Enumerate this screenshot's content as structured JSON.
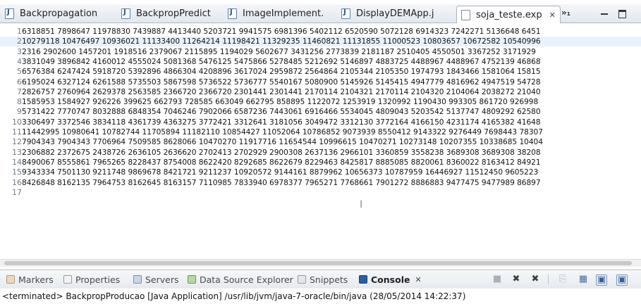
{
  "editor_tabs": [
    {
      "label": "Backpropagation"
    },
    {
      "label": "BackpropPredict"
    },
    {
      "label": "ImageImplement."
    },
    {
      "label": "DisplayDEMApp.j"
    },
    {
      "label": "soja_teste.exp",
      "close": "✕",
      "active": true
    }
  ],
  "tab_overflow": "»₁",
  "editor": {
    "current_line": 2,
    "lines": [
      {
        "n": "1",
        "text": "6318851 7898647 11978830 7439887 4413440 5203721 9941575 6981396 5402112 6520590 5072128 6914323 7242271 5136648 6451"
      },
      {
        "n": "2",
        "text": "10279118 10476497 10936021 11133400 11264214 11198421 11329235 11460821 11131855 11000523 10803657 10672582 10540996"
      },
      {
        "n": "3",
        "text": "2316 2902600 1457201 1918516 2379067 2115895 1194029 5602677 3431256 2773839 2181187 2510405 4550501 3367252 3171929"
      },
      {
        "n": "4",
        "text": "3831049 3896842 4160012 4555024 5081368 5476125 5475866 5278485 5212692 5146897 4883725 4488967 4488967 4752139 46868"
      },
      {
        "n": "5",
        "text": "6576384 6247424 5918720 5392896 4866304 4208896 3617024 2959872 2564864 2105344 2105350 1974793 1843466 1581064 15815"
      },
      {
        "n": "6",
        "text": "6195024 6327124 6261588 5735503 5867598 5736522 5736777 5540167 5080900 5145926 5145415 4947779 4816962 4947519 54728"
      },
      {
        "n": "7",
        "text": "2826757 2760964 2629378 2563585 2366720 2366720 2301441 2301441 2170114 2104321 2170114 2104320 2104064 2038272 21040"
      },
      {
        "n": "8",
        "text": "1585953 1584927 926226 399625 662793 728585 663049 662795 858895 1122072 1253919 1320992 1190430 993305 861720 926998"
      },
      {
        "n": "9",
        "text": "5731422 7770747 8032888 6848354 7046246 7902066 6587236 7443061 6916466 5534045 4809043 5203542 5137747 4809292 62580"
      },
      {
        "n": "10",
        "text": "3306497 3372546 3834118 4361739 4363275 3772421 3312641 3181056 3049472 3312130 3772164 4166150 4231174 4165382 41648"
      },
      {
        "n": "11",
        "text": "11442995 10980641 10782744 11705894 11182110 10854427 11052064 10786852 9073939 8550412 9143322 9276449 7698443 78307"
      },
      {
        "n": "12",
        "text": "7904343 7904343 7706964 7509585 8628066 10470270 11917716 11654544 10996615 10470271 10273148 10207355 10338685 10404"
      },
      {
        "n": "13",
        "text": "2306882 2372675 2438726 2636105 2636620 2702413 2702929 2900308 2637136 2966101 3360859 3558238 3689308 3689308 38208"
      },
      {
        "n": "14",
        "text": "8490067 8555861 7965265 8228437 8754008 8622420 8292685 8622679 8229463 8425817 8885085 8820061 8360022 8163412 84921"
      },
      {
        "n": "15",
        "text": "9343334 7501130 9211748 9869678 8421721 9211237 10920572 9144161 8879962 10656373 10787959 16446927 11512450 9605223"
      },
      {
        "n": "16",
        "text": "8426848 8162135 7964753 8162645 8163157 7110985 7833940 6978377 7965271 7768661 7901272 8886883 9477475 9477989 86897"
      },
      {
        "n": "17",
        "text": ""
      }
    ]
  },
  "views": {
    "tabs": [
      {
        "label": "Markers",
        "icon": "markers-icon"
      },
      {
        "label": "Properties",
        "icon": "properties-icon"
      },
      {
        "label": "Servers",
        "icon": "servers-icon"
      },
      {
        "label": "Data Source Explorer",
        "icon": "data-source-icon"
      },
      {
        "label": "Snippets",
        "icon": "snippets-icon"
      },
      {
        "label": "Console",
        "icon": "console-icon",
        "close": "✕",
        "active": true
      }
    ],
    "toolbar": [
      {
        "name": "terminate-icon",
        "glyph": "■"
      },
      {
        "name": "remove-launch-icon",
        "glyph": "✖"
      },
      {
        "name": "remove-all-icon",
        "glyph": "✖"
      },
      {
        "name": "clear-console-icon",
        "glyph": "⎘"
      },
      {
        "name": "scroll-lock-icon",
        "glyph": "▦"
      },
      {
        "name": "pin-console-icon",
        "glyph": "▣"
      },
      {
        "name": "display-selected-console-icon",
        "glyph": "▣"
      }
    ]
  },
  "status": {
    "text": "<terminated> BackpropProducao [Java Application] /usr/lib/jvm/java-7-oracle/bin/java (28/05/2014 14:22:37)"
  },
  "colors": {
    "current_line_bg": "#e8f2fe",
    "line_number": "#6f7a86",
    "console_icon": "#2c5fa3"
  }
}
